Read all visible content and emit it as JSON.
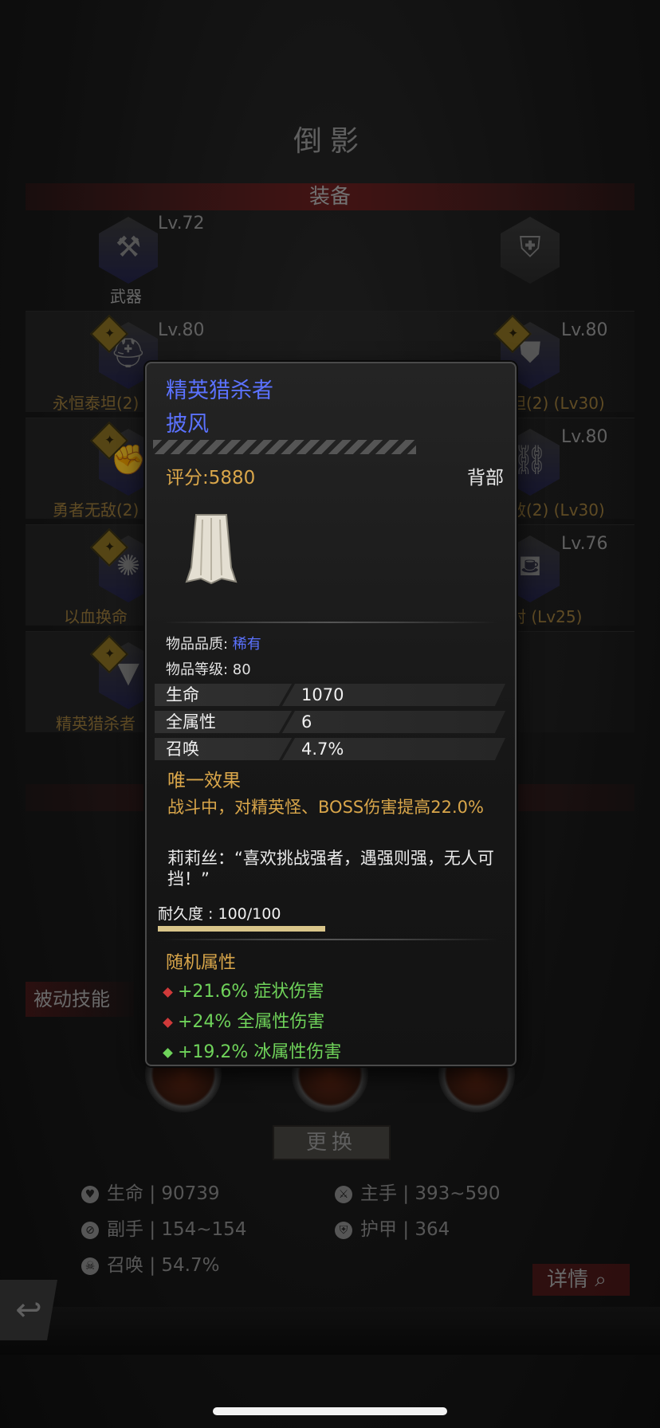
{
  "panel": {
    "title": "倒影",
    "equip_section": "装备"
  },
  "slots": [
    {
      "id": "weapon",
      "name": "武器",
      "level": "Lv.72",
      "icon": "axe-icon"
    },
    {
      "id": "offhand",
      "name": "",
      "level": "",
      "icon": "shield-icon"
    },
    {
      "id": "head",
      "name": "永恒泰坦(2)",
      "level": "Lv.80",
      "icon": "helmet-icon"
    },
    {
      "id": "chest",
      "name": "坦(2)  (Lv30)",
      "level": "Lv.80",
      "icon": "armor-icon"
    },
    {
      "id": "hands",
      "name": "勇者无敌(2)",
      "level": "",
      "icon": "gauntlet-icon"
    },
    {
      "id": "legs",
      "name": "敌(2)  (Lv30)",
      "level": "Lv.80",
      "icon": "greaves-icon"
    },
    {
      "id": "amulet",
      "name": "以血换命",
      "level": "",
      "icon": "amulet-icon"
    },
    {
      "id": "belt",
      "name": "射  (Lv25)",
      "level": "Lv.76",
      "icon": "belt-icon"
    },
    {
      "id": "back",
      "name": "精英猎杀者",
      "level": "",
      "icon": "cape-icon"
    }
  ],
  "passive_label": "被动技能",
  "swap_button": "更换",
  "stats": [
    {
      "icon": "heart-icon",
      "label": "生命",
      "sep": "|",
      "value": "90739"
    },
    {
      "icon": "sword-icon",
      "label": "主手",
      "sep": "|",
      "value": "393~590"
    },
    {
      "icon": "offhand-icon",
      "label": "副手",
      "sep": "|",
      "value": "154~154"
    },
    {
      "icon": "armor-stat-icon",
      "label": "护甲",
      "sep": "|",
      "value": "364"
    },
    {
      "icon": "summon-icon",
      "label": "召唤",
      "sep": "|",
      "value": "54.7%"
    }
  ],
  "detail_button": "详情",
  "tooltip": {
    "name": "精英猎杀者",
    "type": "披风",
    "score": "评分:5880",
    "slot": "背部",
    "quality_label": "物品品质: ",
    "quality_value": "稀有",
    "item_level": "物品等级:  80",
    "attributes": [
      {
        "key": "生命",
        "value": "1070"
      },
      {
        "key": "全属性",
        "value": "6"
      },
      {
        "key": "召唤",
        "value": "4.7%"
      }
    ],
    "unique_header": "唯一效果",
    "unique_text": "战斗中，对精英怪、BOSS伤害提高22.0%",
    "quote": "莉莉丝：“喜欢挑战强者，遇强则强，无人可挡！”",
    "durability": "耐久度 : 100/100",
    "durability_fraction": 1.0,
    "random_header": "随机属性",
    "random_affixes": [
      {
        "text": "+21.6% 症状伤害",
        "gem_color": "#d03a3a"
      },
      {
        "text": "+24% 全属性伤害",
        "gem_color": "#d03a3a"
      },
      {
        "text": "+19.2% 冰属性伤害",
        "gem_color": "#6fd35a"
      }
    ]
  },
  "colors": {
    "rare_blue": "#5b72ff",
    "gold": "#d9a64a",
    "green": "#6fd35a"
  }
}
